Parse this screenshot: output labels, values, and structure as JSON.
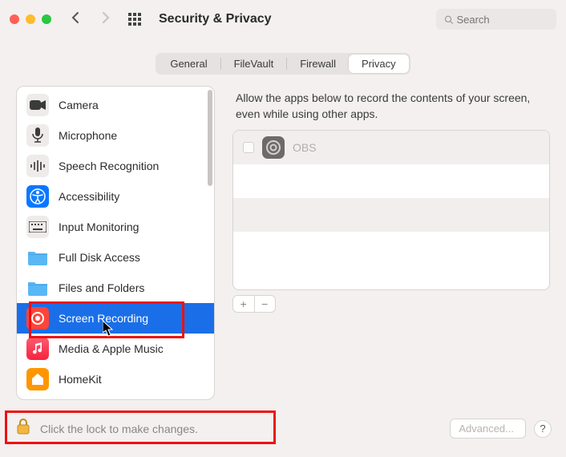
{
  "window": {
    "title": "Security & Privacy"
  },
  "search": {
    "placeholder": "Search"
  },
  "tabs": [
    {
      "label": "General"
    },
    {
      "label": "FileVault"
    },
    {
      "label": "Firewall"
    },
    {
      "label": "Privacy",
      "active": true
    }
  ],
  "sidebar": {
    "items": [
      {
        "label": "Camera"
      },
      {
        "label": "Microphone"
      },
      {
        "label": "Speech Recognition"
      },
      {
        "label": "Accessibility"
      },
      {
        "label": "Input Monitoring"
      },
      {
        "label": "Full Disk Access"
      },
      {
        "label": "Files and Folders"
      },
      {
        "label": "Screen Recording",
        "selected": true
      },
      {
        "label": "Media & Apple Music"
      },
      {
        "label": "HomeKit"
      }
    ]
  },
  "detail": {
    "description": "Allow the apps below to record the contents of your screen, even while using other apps.",
    "apps": [
      {
        "name": "OBS",
        "checked": false
      }
    ]
  },
  "footer": {
    "lock_text": "Click the lock to make changes.",
    "advanced_label": "Advanced..."
  }
}
